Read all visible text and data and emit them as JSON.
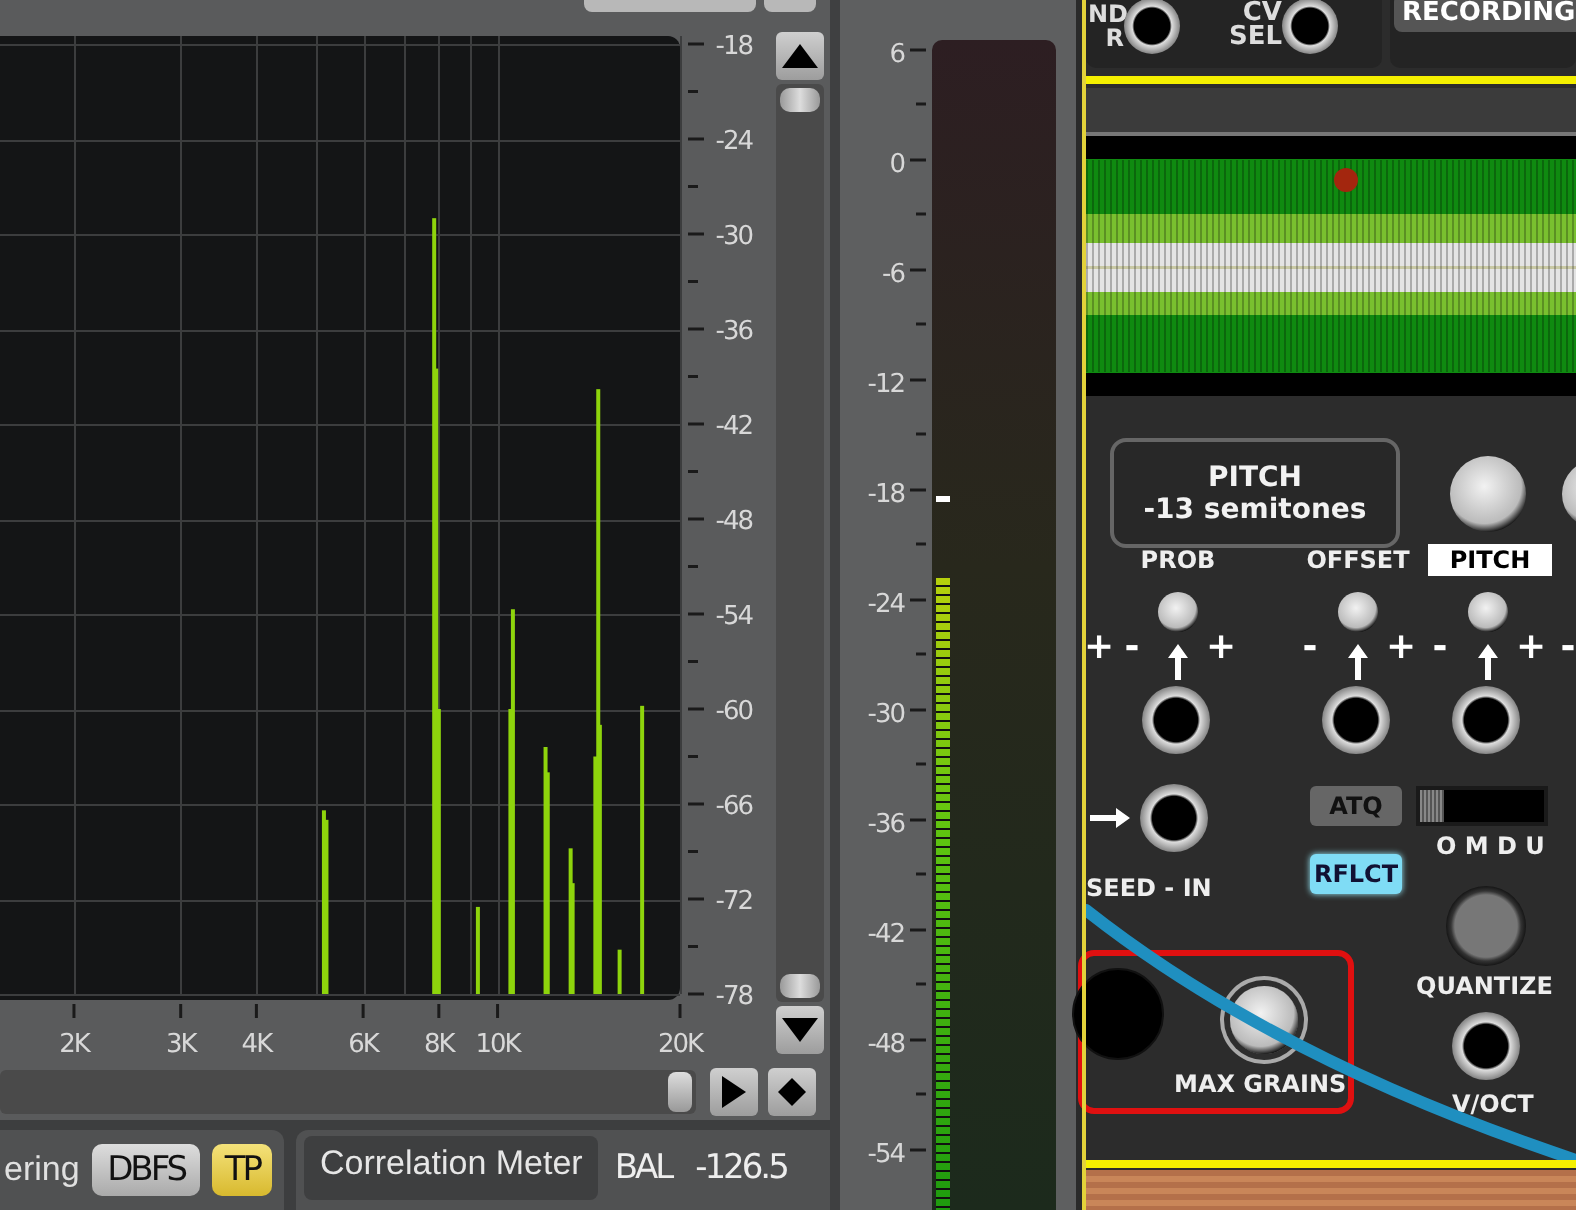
{
  "analyzer": {
    "y_labels": [
      "-18",
      "-24",
      "-30",
      "-36",
      "-42",
      "-48",
      "-54",
      "-60",
      "-66",
      "-72",
      "-78"
    ],
    "x_labels": [
      "2K",
      "3K",
      "4K",
      "6K",
      "8K",
      "10K",
      "20K"
    ]
  },
  "bottom_bar": {
    "metering_label": "ering",
    "scale_buttons": [
      {
        "label": "DBFS",
        "selected": false
      },
      {
        "label": "TP",
        "selected": true
      }
    ],
    "tab": "Correlation Meter",
    "balance": {
      "label": "BAL",
      "value": "-126.5"
    }
  },
  "meter": {
    "scale": [
      "6",
      "0",
      "-6",
      "-12",
      "-18",
      "-24",
      "-30",
      "-36",
      "-42",
      "-48",
      "-54"
    ],
    "level": 0.54,
    "peak": {
      "level": 0.605
    }
  },
  "module": {
    "jack_labels": [
      "ND R",
      "CV SEL"
    ],
    "recording": "RECORDING",
    "tooltip": {
      "title": "PITCH",
      "value": "-13 semitones"
    },
    "knob_labels": [
      {
        "label": "PROB",
        "selected": false
      },
      {
        "label": "OFFSET",
        "selected": false
      },
      {
        "label": "PITCH",
        "selected": true
      }
    ],
    "signs": [
      "+",
      "-",
      "+",
      "-",
      "+",
      "-",
      "+",
      "-"
    ],
    "toggles": [
      {
        "label": "ATQ",
        "on": false
      },
      {
        "label": "RFLCT",
        "on": true
      }
    ],
    "switch": {
      "label": "O M D U",
      "level": 0
    },
    "seed_label": "SEED - IN",
    "quantize_label": "QUANTIZE",
    "max_grains_label": "MAX GRAINS",
    "voct_label": "V/OCT"
  }
}
